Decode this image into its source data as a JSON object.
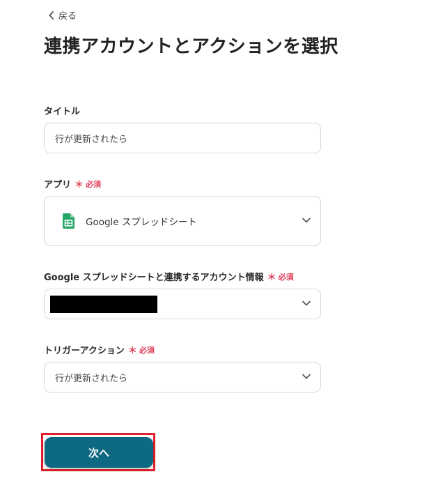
{
  "nav": {
    "back_label": "戻る"
  },
  "page": {
    "title": "連携アカウントとアクションを選択"
  },
  "form": {
    "required_label": "必須",
    "required_mark": "＊",
    "title_field": {
      "label": "タイトル",
      "value": "行が更新されたら"
    },
    "app_field": {
      "label": "アプリ",
      "value": "Google スプレッドシート",
      "icon": "google-sheets-icon"
    },
    "account_field": {
      "label": "Google スプレッドシートと連携するアカウント情報",
      "value_redacted": true
    },
    "trigger_field": {
      "label": "トリガーアクション",
      "value": "行が更新されたら"
    }
  },
  "actions": {
    "next_label": "次へ"
  },
  "colors": {
    "primary": "#0e6982",
    "required": "#e0405a",
    "highlight": "#e0202a",
    "sheets_green": "#23a566"
  }
}
